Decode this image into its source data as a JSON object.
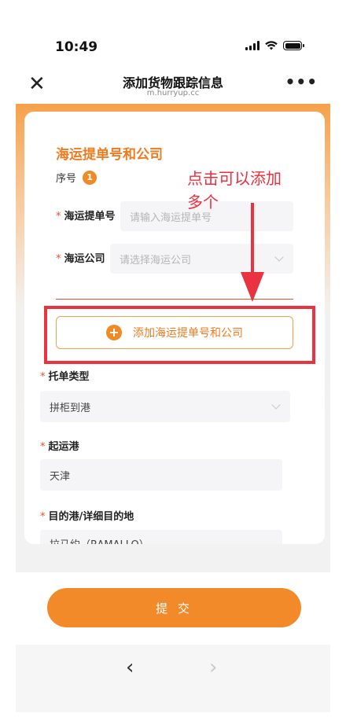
{
  "status": {
    "time": "10:49"
  },
  "nav": {
    "close_glyph": "✕",
    "title": "添加货物跟踪信息",
    "url": "m.hurryup.cc",
    "more_glyph": "•••"
  },
  "form": {
    "section_title": "海运提单号和公司",
    "seq_label": "序号",
    "seq_number": "1",
    "bl_label": "海运提单号",
    "bl_placeholder": "请输入海运提单号",
    "company_label": "海运公司",
    "company_placeholder": "请选择海运公司",
    "add_button_label": "添加海运提单号和公司",
    "add_button_glyph": "+",
    "required_mark": "*",
    "booking_type_label": "托单类型",
    "booking_type_value": "拼柜到港",
    "origin_port_label": "起运港",
    "origin_port_value": "天津",
    "destination_label": "目的港/详细目的地",
    "destination_value": "拉马约（RAMALLO）"
  },
  "annotation": {
    "text": "点击可以添加多个"
  },
  "submit": {
    "label": "提 交"
  },
  "browser": {
    "back_glyph": "‹",
    "forward_glyph": "›"
  },
  "colors": {
    "accent": "#f08a25",
    "annotation_red": "#ea3340",
    "required": "#e8502a"
  },
  "icons": [
    "close-icon",
    "more-icon",
    "plus-circle-icon",
    "chevron-down-icon",
    "back-arrow-icon",
    "forward-arrow-icon",
    "signal-icon",
    "wifi-icon",
    "battery-icon"
  ]
}
